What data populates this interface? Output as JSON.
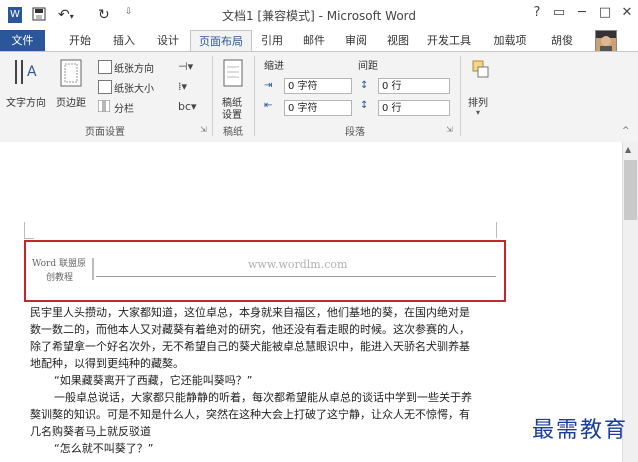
{
  "window": {
    "title": "文档1 [兼容模式] - Microsoft Word",
    "controls": [
      "?",
      "▭",
      "─",
      "□",
      "✕"
    ]
  },
  "quick_access": [
    "word-icon",
    "save-icon",
    "undo-icon",
    "redo-icon",
    "customize-icon"
  ],
  "tabs": {
    "file": "文件",
    "items": [
      "开始",
      "插入",
      "设计",
      "页面布局",
      "引用",
      "邮件",
      "审阅",
      "视图",
      "开发工具",
      "加载项"
    ],
    "user": "胡俊"
  },
  "ribbon": {
    "page_setup": {
      "text_direction": "文字方向",
      "margins": "页边距",
      "orientation": "纸张方向",
      "size": "纸张大小",
      "columns": "分栏",
      "label": "页面设置"
    },
    "manuscript": {
      "button": "稿纸设置",
      "btn_line1": "稿纸",
      "btn_line2": "设置",
      "label": "稿纸"
    },
    "paragraph": {
      "indent": "缩进",
      "spacing": "间距",
      "indent_left": "0 字符",
      "indent_right": "0 字符",
      "spacing_before": "0 行",
      "spacing_after": "0 行",
      "label": "段落"
    },
    "arrange": {
      "button": "排列"
    }
  },
  "document": {
    "header_left_line1": "Word 联盟原",
    "header_left_line2": "创教程",
    "header_url": "www.wordlm.com",
    "paragraphs": [
      "民宇里人头攒动，大家都知道，这位卓总，本身就来自福区，他们基地的葵，在国内绝对是",
      "数一数二的，而他本人又对藏葵有着绝对的研究，他还没有看走眼的时候。这次参赛的人，",
      "除了希望拿一个好名次外，无不希望自己的葵犬能被卓总慧眼识中，能进入天骄名犬驯养基",
      "地配种，以得到更纯种的藏獒。",
      "“如果藏葵离开了西藏，它还能叫葵吗？”",
      "一般卓总说话，大家都只能静静的听着，每次都希望能从卓总的谈话中学到一些关于养",
      "獒训獒的知识。可是不知是什么人，突然在这种大会上打破了这宁静，让众人无不惊愕，有",
      "几名购葵者马上就反驳道",
      "“怎么就不叫葵了？”"
    ]
  },
  "watermark": "最需教育"
}
